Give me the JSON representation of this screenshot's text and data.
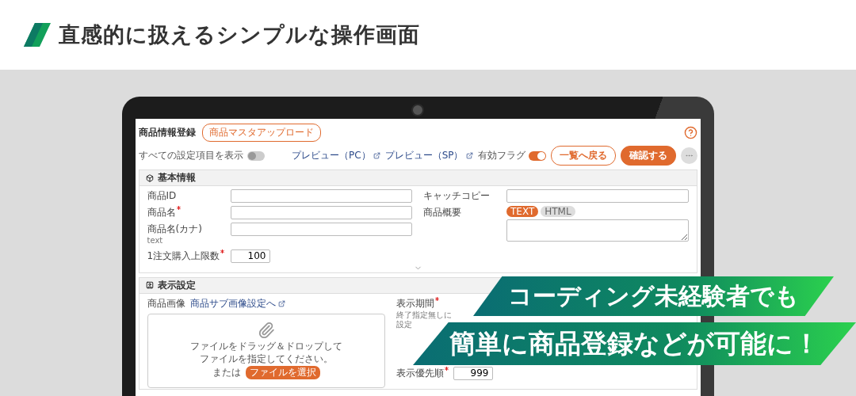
{
  "headline": "直感的に扱えるシンプルな操作画面",
  "app": {
    "title": "商品情報登録",
    "upload_button": "商品マスタアップロード",
    "show_all": {
      "label": "すべての設定項目を表示",
      "on": false
    },
    "preview_links": [
      "プレビュー（PC）",
      "プレビュー（SP）"
    ],
    "active_flag": {
      "label": "有効フラグ",
      "on": true
    },
    "back_button": "一覧へ戻る",
    "confirm_button": "確認する",
    "basic_section": {
      "title": "基本情報",
      "left_fields": [
        {
          "label": "商品ID",
          "required": false,
          "kind": "text"
        },
        {
          "label": "商品名",
          "required": true,
          "kind": "text"
        },
        {
          "label": "商品名(カナ)",
          "hint": "text",
          "required": false,
          "kind": "text"
        },
        {
          "label": "1注文購入上限数",
          "required": true,
          "kind": "number",
          "value": "100"
        }
      ],
      "right_fields": [
        {
          "label": "キャッチコピー",
          "required": false,
          "kind": "text"
        },
        {
          "label": "商品概要",
          "required": false,
          "kind": "textarea",
          "modes": [
            {
              "label": "TEXT",
              "selected": true
            },
            {
              "label": "HTML",
              "selected": false
            }
          ]
        }
      ]
    },
    "display_section": {
      "title": "表示設定",
      "image_label": "商品画像",
      "sub_image_link": "商品サブ画像設定へ",
      "drop_text_lines": [
        "ファイルをドラッグ＆ドロップして",
        "ファイルを指定してください。"
      ],
      "or_text": "または",
      "choose_button": "ファイルを選択",
      "right_fields": [
        {
          "label": "表示期間",
          "required": true,
          "hint": "終了指定無しに設定",
          "kind": "label"
        },
        {
          "label": "表示優先順",
          "required": true,
          "kind": "number",
          "value": "999"
        }
      ]
    }
  },
  "callouts": [
    "コーディング未経験者でも",
    "簡単に商品登録などが可能に！"
  ]
}
